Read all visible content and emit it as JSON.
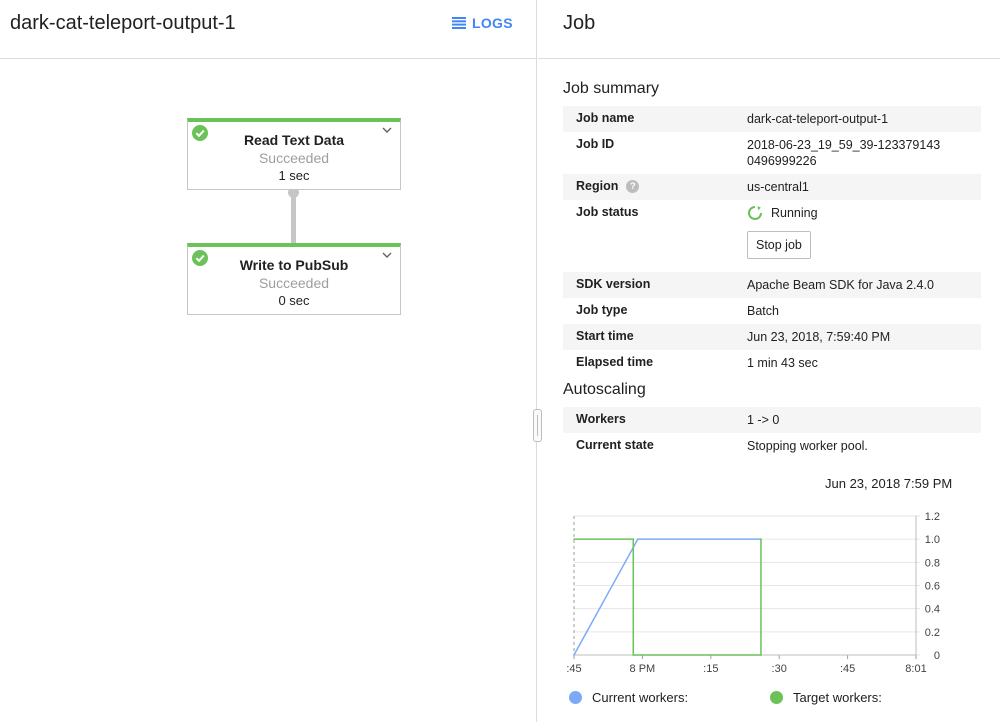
{
  "left": {
    "title": "dark-cat-teleport-output-1",
    "logs_label": "LOGS",
    "steps": [
      {
        "name": "Read Text Data",
        "status": "Succeeded",
        "time": "1 sec"
      },
      {
        "name": "Write to PubSub",
        "status": "Succeeded",
        "time": "0 sec"
      }
    ]
  },
  "right": {
    "title": "Job",
    "summary": {
      "heading": "Job summary",
      "job_name_label": "Job name",
      "job_name": "dark-cat-teleport-output-1",
      "job_id_label": "Job ID",
      "job_id": "2018-06-23_19_59_39-1233791430496999226",
      "region_label": "Region",
      "region": "us-central1",
      "status_label": "Job status",
      "status": "Running",
      "stop_label": "Stop job",
      "sdk_label": "SDK version",
      "sdk": "Apache Beam SDK for Java 2.4.0",
      "type_label": "Job type",
      "type": "Batch",
      "start_label": "Start time",
      "start": "Jun 23, 2018, 7:59:40 PM",
      "elapsed_label": "Elapsed time",
      "elapsed": "1 min 43 sec"
    },
    "autoscaling": {
      "heading": "Autoscaling",
      "workers_label": "Workers",
      "workers": "1 -> 0",
      "state_label": "Current state",
      "state": "Stopping worker pool.",
      "chart_date": "Jun 23, 2018 7:59 PM",
      "legend_current": "Current workers:",
      "legend_target": "Target workers:"
    }
  },
  "colors": {
    "success": "#6ac259",
    "accent": "#4285f4",
    "current": "#7baaf7",
    "target": "#6ac259"
  },
  "chart_data": {
    "type": "line",
    "x_tick_labels": [
      ":45",
      "8 PM",
      ":15",
      ":30",
      ":45",
      "8:01"
    ],
    "y_tick_labels": [
      "0",
      "0.2",
      "0.4",
      "0.6",
      "0.8",
      "1.0",
      "1.2"
    ],
    "ylim": [
      0,
      1.2
    ],
    "x_unit": "seconds after 7:59:45 PM (approx)",
    "xlim": [
      0,
      75
    ],
    "series": [
      {
        "name": "Current workers",
        "x": [
          0,
          14,
          41
        ],
        "y": [
          0,
          1,
          1
        ]
      },
      {
        "name": "Target workers",
        "x": [
          0,
          13,
          13,
          41,
          41
        ],
        "y": [
          1,
          1,
          0,
          0,
          1
        ]
      }
    ]
  }
}
